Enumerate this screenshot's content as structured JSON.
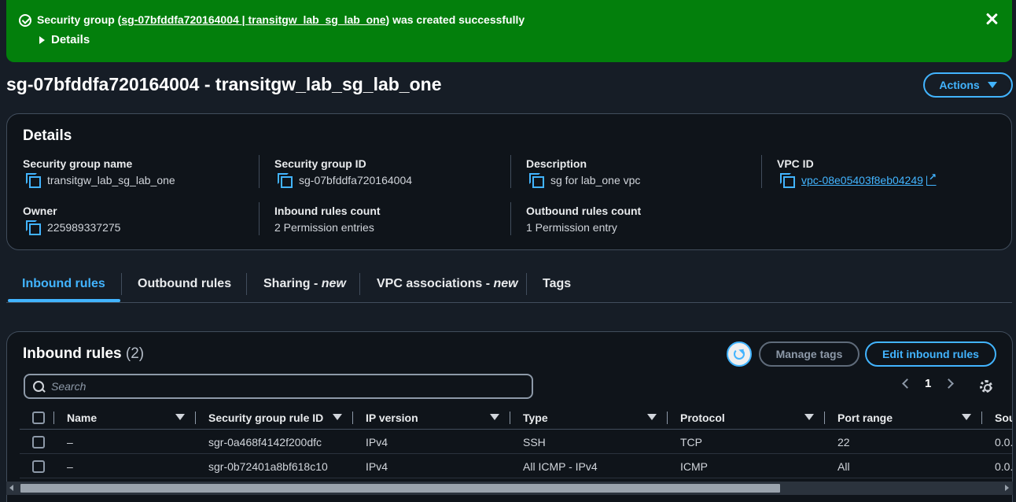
{
  "flash": {
    "prefix": "Security group (",
    "link_text": "sg-07bfddfa720164004 | transitgw_lab_sg_lab_one",
    "suffix": ") was created successfully",
    "details_label": "Details"
  },
  "page": {
    "title": "sg-07bfddfa720164004 - transitgw_lab_sg_lab_one",
    "actions_label": "Actions"
  },
  "details": {
    "heading": "Details",
    "fields": [
      {
        "label": "Security group name",
        "value": "transitgw_lab_sg_lab_one"
      },
      {
        "label": "Security group ID",
        "value": "sg-07bfddfa720164004"
      },
      {
        "label": "Description",
        "value": "sg for lab_one vpc"
      },
      {
        "label": "VPC ID",
        "value": "vpc-08e05403f8eb04249"
      },
      {
        "label": "Owner",
        "value": "225989337275"
      },
      {
        "label": "Inbound rules count",
        "value": "2 Permission entries"
      },
      {
        "label": "Outbound rules count",
        "value": "1 Permission entry"
      }
    ]
  },
  "tabs": [
    {
      "label": "Inbound rules",
      "active": true
    },
    {
      "label": "Outbound rules"
    },
    {
      "label": "Sharing - ",
      "tag": "new"
    },
    {
      "label": "VPC associations - ",
      "tag": "new"
    },
    {
      "label": "Tags"
    }
  ],
  "rules": {
    "heading": "Inbound rules",
    "count": "(2)",
    "manage_tags_label": "Manage tags",
    "edit_label": "Edit inbound rules",
    "search_placeholder": "Search",
    "page_number": "1",
    "columns": [
      "Name",
      "Security group rule ID",
      "IP version",
      "Type",
      "Protocol",
      "Port range",
      "Sou"
    ],
    "rows": [
      {
        "name": "–",
        "rule_id": "sgr-0a468f4142f200dfc",
        "ip_version": "IPv4",
        "type": "SSH",
        "protocol": "TCP",
        "port_range": "22",
        "source": "0.0."
      },
      {
        "name": "–",
        "rule_id": "sgr-0b72401a8bf618c10",
        "ip_version": "IPv4",
        "type": "All ICMP - IPv4",
        "protocol": "ICMP",
        "port_range": "All",
        "source": "0.0."
      }
    ]
  },
  "colors": {
    "success": "#037f0c",
    "accent": "#42b4ff",
    "background": "#161d26"
  }
}
